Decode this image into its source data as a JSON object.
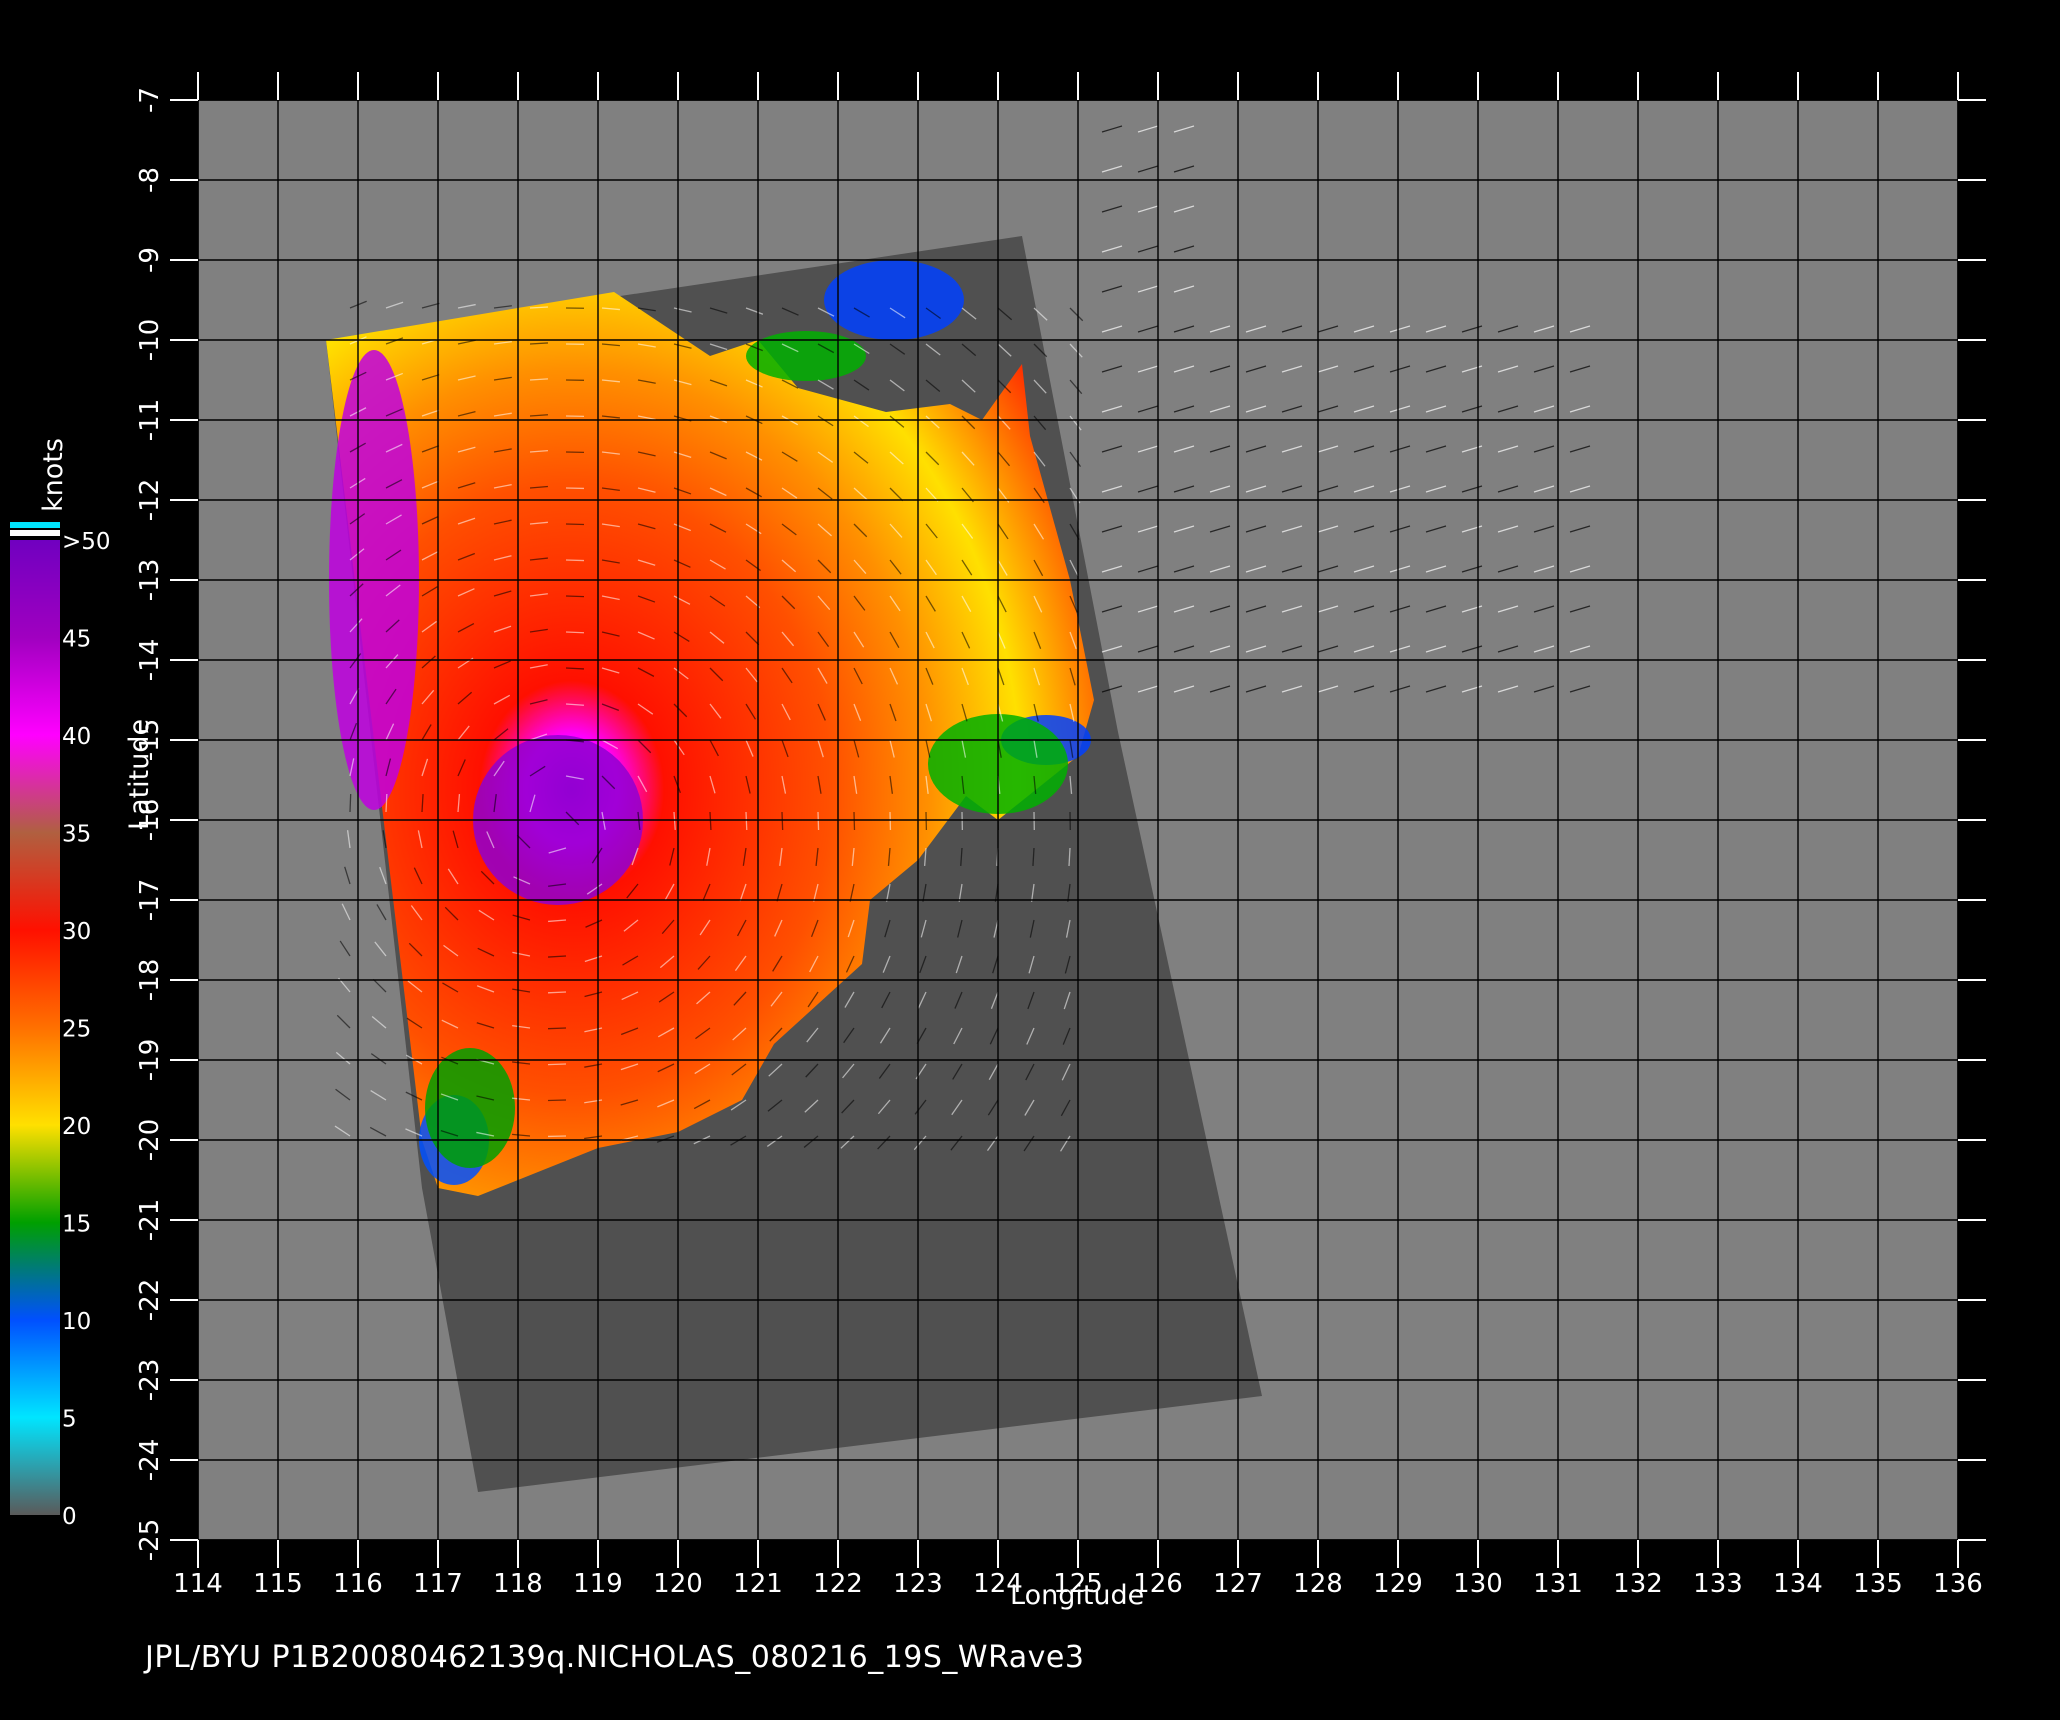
{
  "title": "JPL/BYU  P1B20080462139q.NICHOLAS_080216_19S_WRave3",
  "map": {
    "xlabel": "Longitude",
    "ylabel": "Latitude",
    "xlim": [
      114,
      136
    ],
    "ylim": [
      -25,
      -7
    ],
    "x_ticks": [
      "114",
      "115",
      "116",
      "117",
      "118",
      "119",
      "120",
      "121",
      "122",
      "123",
      "124",
      "125",
      "126",
      "127",
      "128",
      "129",
      "130",
      "131",
      "132",
      "133",
      "134",
      "135",
      "136"
    ],
    "y_ticks": [
      "-7",
      "-8",
      "-9",
      "-10",
      "-11",
      "-12",
      "-13",
      "-14",
      "-15",
      "-16",
      "-17",
      "-18",
      "-19",
      "-20",
      "-21",
      "-22",
      "-23",
      "-24",
      "-25"
    ],
    "grid": true,
    "background_color": "#808080",
    "land_color": "#505050",
    "storm_center": {
      "lon": 118.5,
      "lat": -16.0
    }
  },
  "colorbar": {
    "units": "knots",
    "labels": [
      "0",
      "5",
      "10",
      "15",
      "20",
      "25",
      "30",
      "35",
      "40",
      "45",
      ">50"
    ],
    "colors": [
      "#5a5a5a",
      "#00e5ff",
      "#0050ff",
      "#00a000",
      "#ffe000",
      "#ff7000",
      "#ff1000",
      "#b06040",
      "#ff00ff",
      "#a000c0",
      "#7000c0"
    ]
  }
}
